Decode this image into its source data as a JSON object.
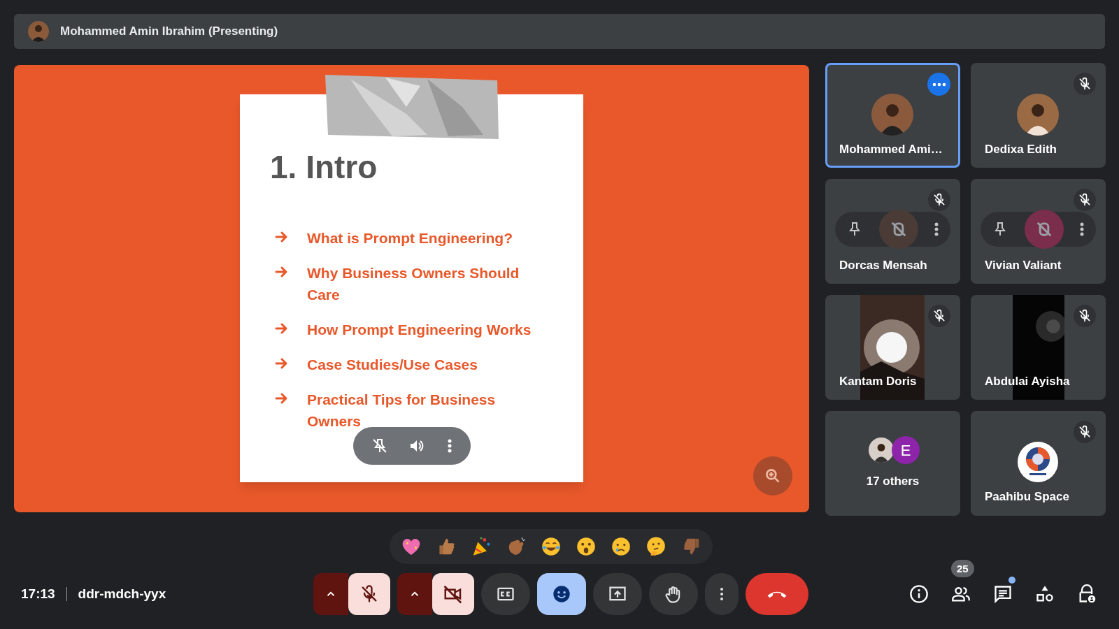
{
  "header": {
    "presenter": "Mohammed Amin Ibrahim (Presenting)"
  },
  "slide": {
    "title": "1. Intro",
    "bullets": [
      "What is Prompt Engineering?",
      "Why Business Owners Should Care",
      "How Prompt Engineering Works",
      "Case Studies/Use Cases",
      "Practical Tips for Business Owners"
    ]
  },
  "tiles": [
    {
      "kind": "avatar",
      "name": "Mohammed Ami…",
      "selected": true,
      "muted": false,
      "hovered": false
    },
    {
      "kind": "avatar",
      "name": "Dedixa Edith",
      "selected": false,
      "muted": true,
      "hovered": false
    },
    {
      "kind": "overlay",
      "name": "Dorcas Mensah",
      "selected": false,
      "muted": true,
      "hovered": true,
      "color": "#4a3b37"
    },
    {
      "kind": "overlay",
      "name": "Vivian Valiant",
      "selected": false,
      "muted": true,
      "hovered": true,
      "color": "#7b2d4c"
    },
    {
      "kind": "video",
      "name": "Kantam Doris",
      "selected": false,
      "muted": true,
      "hovered": false
    },
    {
      "kind": "video",
      "name": "Abdulai Ayisha",
      "selected": false,
      "muted": true,
      "hovered": false
    },
    {
      "kind": "others",
      "name": "17 others",
      "selected": false,
      "muted": false,
      "hovered": false,
      "initial": "E"
    },
    {
      "kind": "logo",
      "name": "Paahibu Space",
      "selected": false,
      "muted": true,
      "hovered": false
    }
  ],
  "reactions": [
    {
      "kind": "heart"
    },
    {
      "kind": "thumbs_up"
    },
    {
      "kind": "party"
    },
    {
      "kind": "clap"
    },
    {
      "kind": "laugh"
    },
    {
      "kind": "surprised"
    },
    {
      "kind": "sad"
    },
    {
      "kind": "thinking"
    },
    {
      "kind": "thumbs_down"
    }
  ],
  "meeting": {
    "time": "17:13",
    "code": "ddr-mdch-yyx"
  },
  "controls": [
    {
      "kind": "mic",
      "on": false
    },
    {
      "kind": "camera",
      "on": false
    },
    {
      "kind": "captions",
      "selected": false
    },
    {
      "kind": "reactions",
      "selected": true
    },
    {
      "kind": "present"
    },
    {
      "kind": "hand"
    },
    {
      "kind": "more"
    },
    {
      "kind": "end"
    }
  ],
  "side_actions": [
    {
      "kind": "info"
    },
    {
      "kind": "people",
      "badge": "25"
    },
    {
      "kind": "chat",
      "unread": true
    },
    {
      "kind": "activities"
    },
    {
      "kind": "host"
    }
  ]
}
